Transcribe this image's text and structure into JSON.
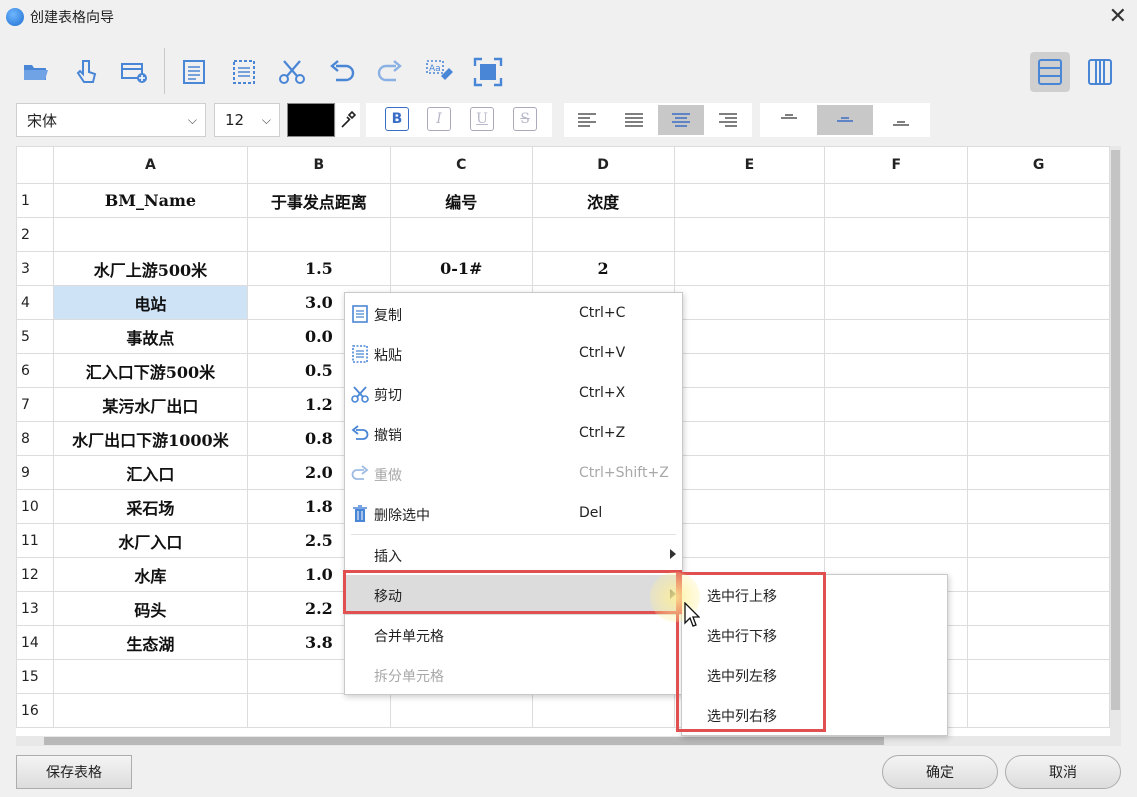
{
  "window": {
    "title": "创建表格向导",
    "close_label": "✕"
  },
  "toolbar": {
    "icons": [
      "open-folder-icon",
      "touch-icon",
      "add-table-icon",
      "copy-icon",
      "paste-icon",
      "scissors-icon",
      "undo-icon",
      "redo-icon",
      "text-format-icon",
      "fit-icon"
    ],
    "view_row": "row-view-icon",
    "view_column": "column-view-icon"
  },
  "format": {
    "font": "宋体",
    "size": "12",
    "color": "#000000",
    "bold": "B",
    "italic": "I",
    "underline": "U",
    "strike": "S"
  },
  "sheet": {
    "columns": [
      "A",
      "B",
      "C",
      "D",
      "E",
      "F",
      "G"
    ],
    "rows": [
      {
        "n": "1",
        "a": "BM_Name",
        "b": "于事发点距离",
        "c": "编号",
        "d": "浓度"
      },
      {
        "n": "2",
        "a": "",
        "b": "",
        "c": "",
        "d": ""
      },
      {
        "n": "3",
        "a": "水厂上游500米",
        "b": "1.5",
        "c": "0-1#",
        "d": "2"
      },
      {
        "n": "4",
        "a": "电站",
        "b": "3.0",
        "c": "",
        "d": ""
      },
      {
        "n": "5",
        "a": "事故点",
        "b": "0.0",
        "c": "",
        "d": ""
      },
      {
        "n": "6",
        "a": "汇入口下游500米",
        "b": "0.5",
        "c": "",
        "d": ""
      },
      {
        "n": "7",
        "a": "某污水厂出口",
        "b": "1.2",
        "c": "",
        "d": ""
      },
      {
        "n": "8",
        "a": "水厂出口下游1000米",
        "b": "0.8",
        "c": "",
        "d": ""
      },
      {
        "n": "9",
        "a": "汇入口",
        "b": "2.0",
        "c": "",
        "d": ""
      },
      {
        "n": "10",
        "a": "采石场",
        "b": "1.8",
        "c": "",
        "d": ""
      },
      {
        "n": "11",
        "a": "水厂入口",
        "b": "2.5",
        "c": "",
        "d": ""
      },
      {
        "n": "12",
        "a": "水库",
        "b": "1.0",
        "c": "",
        "d": ""
      },
      {
        "n": "13",
        "a": "码头",
        "b": "2.2",
        "c": "",
        "d": ""
      },
      {
        "n": "14",
        "a": "生态湖",
        "b": "3.8",
        "c": "",
        "d": ""
      },
      {
        "n": "15",
        "a": "",
        "b": "",
        "c": "",
        "d": ""
      },
      {
        "n": "16",
        "a": "",
        "b": "",
        "c": "",
        "d": ""
      }
    ]
  },
  "context_menu": {
    "copy": {
      "label": "复制",
      "shortcut": "Ctrl+C",
      "icon": "copy-icon"
    },
    "paste": {
      "label": "粘贴",
      "shortcut": "Ctrl+V",
      "icon": "paste-icon"
    },
    "cut": {
      "label": "剪切",
      "shortcut": "Ctrl+X",
      "icon": "scissors-icon"
    },
    "undo": {
      "label": "撤销",
      "shortcut": "Ctrl+Z",
      "icon": "undo-icon"
    },
    "redo": {
      "label": "重做",
      "shortcut": "Ctrl+Shift+Z",
      "icon": "redo-icon"
    },
    "delete": {
      "label": "删除选中",
      "shortcut": "Del",
      "icon": "trash-icon"
    },
    "insert": {
      "label": "插入"
    },
    "move": {
      "label": "移动"
    },
    "merge": {
      "label": "合并单元格"
    },
    "split": {
      "label": "拆分单元格"
    }
  },
  "submenu": {
    "row_up": "选中行上移",
    "row_down": "选中行下移",
    "col_left": "选中列左移",
    "col_right": "选中列右移"
  },
  "footer": {
    "save": "保存表格",
    "ok": "确定",
    "cancel": "取消"
  },
  "colors": {
    "selection": "#cfe3f7",
    "highlight": "#e05050",
    "accent": "#3a6ec6"
  }
}
